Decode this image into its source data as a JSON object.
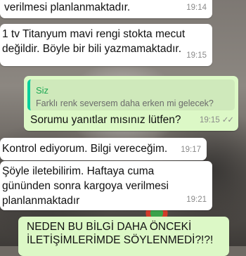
{
  "messages": [
    {
      "text": "verilmesi planlanmaktadır.",
      "time": "19:14"
    },
    {
      "line1": "1 tv Titanyum mavi rengi stokta mecut",
      "line2": "değildir. Böyle bir bili yazmamaktadır.",
      "time": "19:15"
    },
    {
      "quote_author": "Siz",
      "quote_text": "Farklı renk seversem daha erken mi gelecek?",
      "text": "Sorumu yanıtlar mısınız lütfen?",
      "time": "19:15",
      "ticks": "✓✓"
    },
    {
      "text": "Kontrol ediyorum. Bilgi vereceğim.",
      "time": "19:17"
    },
    {
      "line1": "Şöyle iletebilirim. Haftaya cuma",
      "line2": "gününden sonra kargoya verilmesi",
      "line3": "planlanmaktadır",
      "time": "19:21"
    },
    {
      "line1": "NEDEN BU BİLGİ DAHA ÖNCEKİ",
      "line2": "İLETİŞİMLERİMDE SÖYLENMEDİ?!?!"
    }
  ],
  "colors": {
    "incoming": "#ffffff",
    "outgoing": "#dcf8c6",
    "quote_accent": "#06cf9c"
  }
}
